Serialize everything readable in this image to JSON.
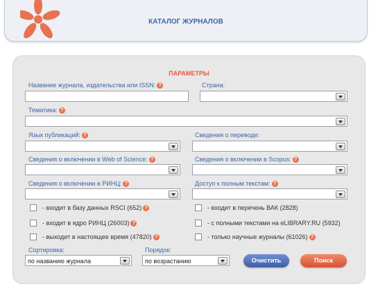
{
  "header": {
    "title": "КАТАЛОГ ЖУРНАЛОВ"
  },
  "panel": {
    "title": "ПАРАМЕТРЫ"
  },
  "fields": {
    "journal_name_label": "Название журнала, издательства или ISSN:",
    "country_label": "Страна:",
    "topic_label": "Тематика:",
    "language_label": "Язык публикаций:",
    "translation_label": "Сведения о переводе:",
    "wos_label": "Сведения о включении в Web of Science:",
    "scopus_label": "Сведения о включении в Scopus:",
    "rinc_label": "Сведения о включении в РИНЦ:",
    "fulltext_label": "Доступ к полным текстам:"
  },
  "help_icon": "?",
  "checkboxes": {
    "rsci": "- входит в базу данных RSCI (652)",
    "vak": "- входит в перечень ВАК (2828)",
    "rinc_core": "- входит в ядро РИНЦ (26003)",
    "elibrary_fulltext": "- с полными текстами на eLIBRARY.RU (5932)",
    "current": "- выходит в настоящее время (47820)",
    "scientific_only": "- только научные журналы (61026)"
  },
  "sort": {
    "label": "Сортировка:",
    "value": "по названию журнала"
  },
  "order": {
    "label": "Порядок:",
    "value": "по возрастанию"
  },
  "buttons": {
    "clear": "Очистить",
    "search": "Поиск"
  },
  "colors": {
    "accent_blue": "#3c64a8",
    "accent_orange": "#e8593a"
  }
}
